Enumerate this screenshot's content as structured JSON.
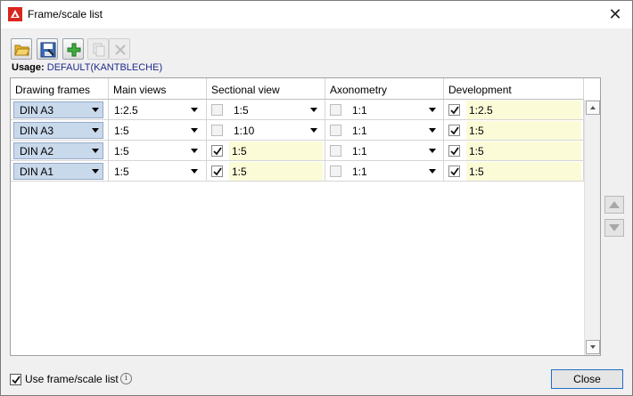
{
  "window": {
    "title": "Frame/scale list",
    "close_icon": "close-icon"
  },
  "toolbar": {
    "buttons": [
      {
        "name": "open-folder-button",
        "icon": "folder-open-icon",
        "enabled": true
      },
      {
        "name": "save-list-button",
        "icon": "save-icon",
        "enabled": true
      },
      {
        "name": "add-row-button",
        "icon": "plus-icon",
        "enabled": true
      },
      {
        "name": "copy-row-button",
        "icon": "copy-icon",
        "enabled": false
      },
      {
        "name": "delete-row-button",
        "icon": "delete-icon",
        "enabled": false
      }
    ]
  },
  "usage": {
    "label": "Usage:",
    "value": "DEFAULT(KANTBLECHE)"
  },
  "table": {
    "columns": [
      "Drawing frames",
      "Main views",
      "Sectional view",
      "Axonometry",
      "Development"
    ],
    "rows": [
      {
        "frame": "DIN A3",
        "main": "1:2.5",
        "sectional_checked": false,
        "sectional": "1:5",
        "axon_checked": false,
        "axon": "1:1",
        "dev_checked": true,
        "dev": "1:2.5"
      },
      {
        "frame": "DIN A3",
        "main": "1:5",
        "sectional_checked": false,
        "sectional": "1:10",
        "axon_checked": false,
        "axon": "1:1",
        "dev_checked": true,
        "dev": "1:5"
      },
      {
        "frame": "DIN A2",
        "main": "1:5",
        "sectional_checked": true,
        "sectional": "1:5",
        "axon_checked": false,
        "axon": "1:1",
        "dev_checked": true,
        "dev": "1:5"
      },
      {
        "frame": "DIN A1",
        "main": "1:5",
        "sectional_checked": true,
        "sectional": "1:5",
        "axon_checked": false,
        "axon": "1:1",
        "dev_checked": true,
        "dev": "1:5"
      }
    ]
  },
  "footer": {
    "use_list_label": "Use frame/scale list",
    "use_list_checked": true,
    "close_label": "Close"
  },
  "colors": {
    "accent": "#1f6fc5",
    "frame_select_bg": "#c9d9ec",
    "highlight_cell": "#fbfbd8",
    "usage_value": "#1f2a8a"
  }
}
